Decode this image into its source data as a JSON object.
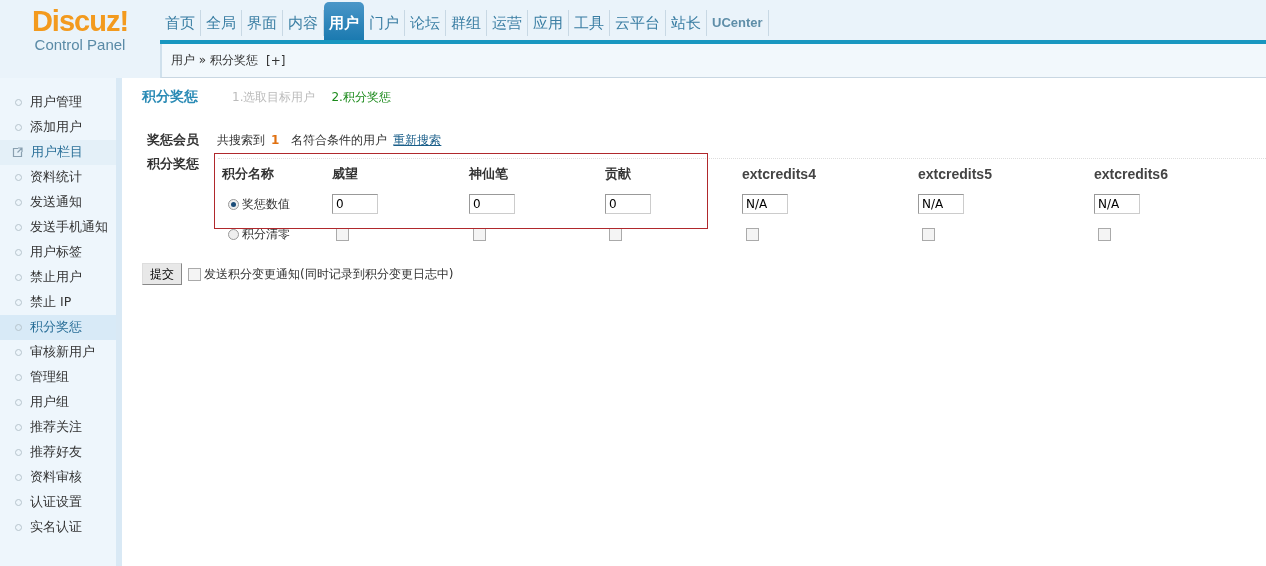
{
  "logo": {
    "title": "Discuz!",
    "subtitle": "Control Panel"
  },
  "nav": [
    {
      "label": "首页",
      "selected": false
    },
    {
      "label": "全局",
      "selected": false
    },
    {
      "label": "界面",
      "selected": false
    },
    {
      "label": "内容",
      "selected": false
    },
    {
      "label": "用户",
      "selected": true
    },
    {
      "label": "门户",
      "selected": false
    },
    {
      "label": "论坛",
      "selected": false
    },
    {
      "label": "群组",
      "selected": false
    },
    {
      "label": "运营",
      "selected": false
    },
    {
      "label": "应用",
      "selected": false
    },
    {
      "label": "工具",
      "selected": false
    },
    {
      "label": "云平台",
      "selected": false
    },
    {
      "label": "站长",
      "selected": false
    },
    {
      "label": "UCenter",
      "selected": false
    }
  ],
  "breadcrumb": {
    "path": "用户 » 积分奖惩",
    "add": "[+]"
  },
  "sidebar": {
    "items": [
      {
        "label": "用户管理",
        "kind": "item",
        "selected": false
      },
      {
        "label": "添加用户",
        "kind": "item",
        "selected": false
      },
      {
        "label": "用户栏目",
        "kind": "shortcut",
        "selected": false
      },
      {
        "label": "资料统计",
        "kind": "item",
        "selected": false
      },
      {
        "label": "发送通知",
        "kind": "item",
        "selected": false
      },
      {
        "label": "发送手机通知",
        "kind": "item",
        "selected": false
      },
      {
        "label": "用户标签",
        "kind": "item",
        "selected": false
      },
      {
        "label": "禁止用户",
        "kind": "item",
        "selected": false
      },
      {
        "label": "禁止 IP",
        "kind": "item",
        "selected": false
      },
      {
        "label": "积分奖惩",
        "kind": "item",
        "selected": true
      },
      {
        "label": "审核新用户",
        "kind": "item",
        "selected": false
      },
      {
        "label": "管理组",
        "kind": "item",
        "selected": false
      },
      {
        "label": "用户组",
        "kind": "item",
        "selected": false
      },
      {
        "label": "推荐关注",
        "kind": "item",
        "selected": false
      },
      {
        "label": "推荐好友",
        "kind": "item",
        "selected": false
      },
      {
        "label": "资料审核",
        "kind": "item",
        "selected": false
      },
      {
        "label": "认证设置",
        "kind": "item",
        "selected": false
      },
      {
        "label": "实名认证",
        "kind": "item",
        "selected": false
      }
    ]
  },
  "page": {
    "title": "积分奖惩",
    "steps": [
      {
        "label": "1.选取目标用户",
        "selected": false
      },
      {
        "label": "2.积分奖惩",
        "selected": true
      }
    ]
  },
  "members": {
    "label": "奖惩会员",
    "prefix": "共搜索到",
    "count": "1",
    "suffix": "名符合条件的用户",
    "link": "重新搜索"
  },
  "credits": {
    "label": "积分奖惩",
    "header": "积分名称",
    "options": [
      {
        "label": "奖惩数值",
        "selected": true
      },
      {
        "label": "积分清零",
        "selected": false
      }
    ],
    "columns": [
      {
        "name": "威望",
        "value": "0",
        "clear": false
      },
      {
        "name": "神仙笔",
        "value": "0",
        "clear": false
      },
      {
        "name": "贡献",
        "value": "0",
        "clear": false
      },
      {
        "name": "extcredits4",
        "value": "N/A",
        "clear": false
      },
      {
        "name": "extcredits5",
        "value": "N/A",
        "clear": false
      },
      {
        "name": "extcredits6",
        "value": "N/A",
        "clear": false
      }
    ]
  },
  "submit": "提交",
  "notify": {
    "label": "发送积分变更通知(同时记录到积分变更日志中)",
    "checked": false
  }
}
